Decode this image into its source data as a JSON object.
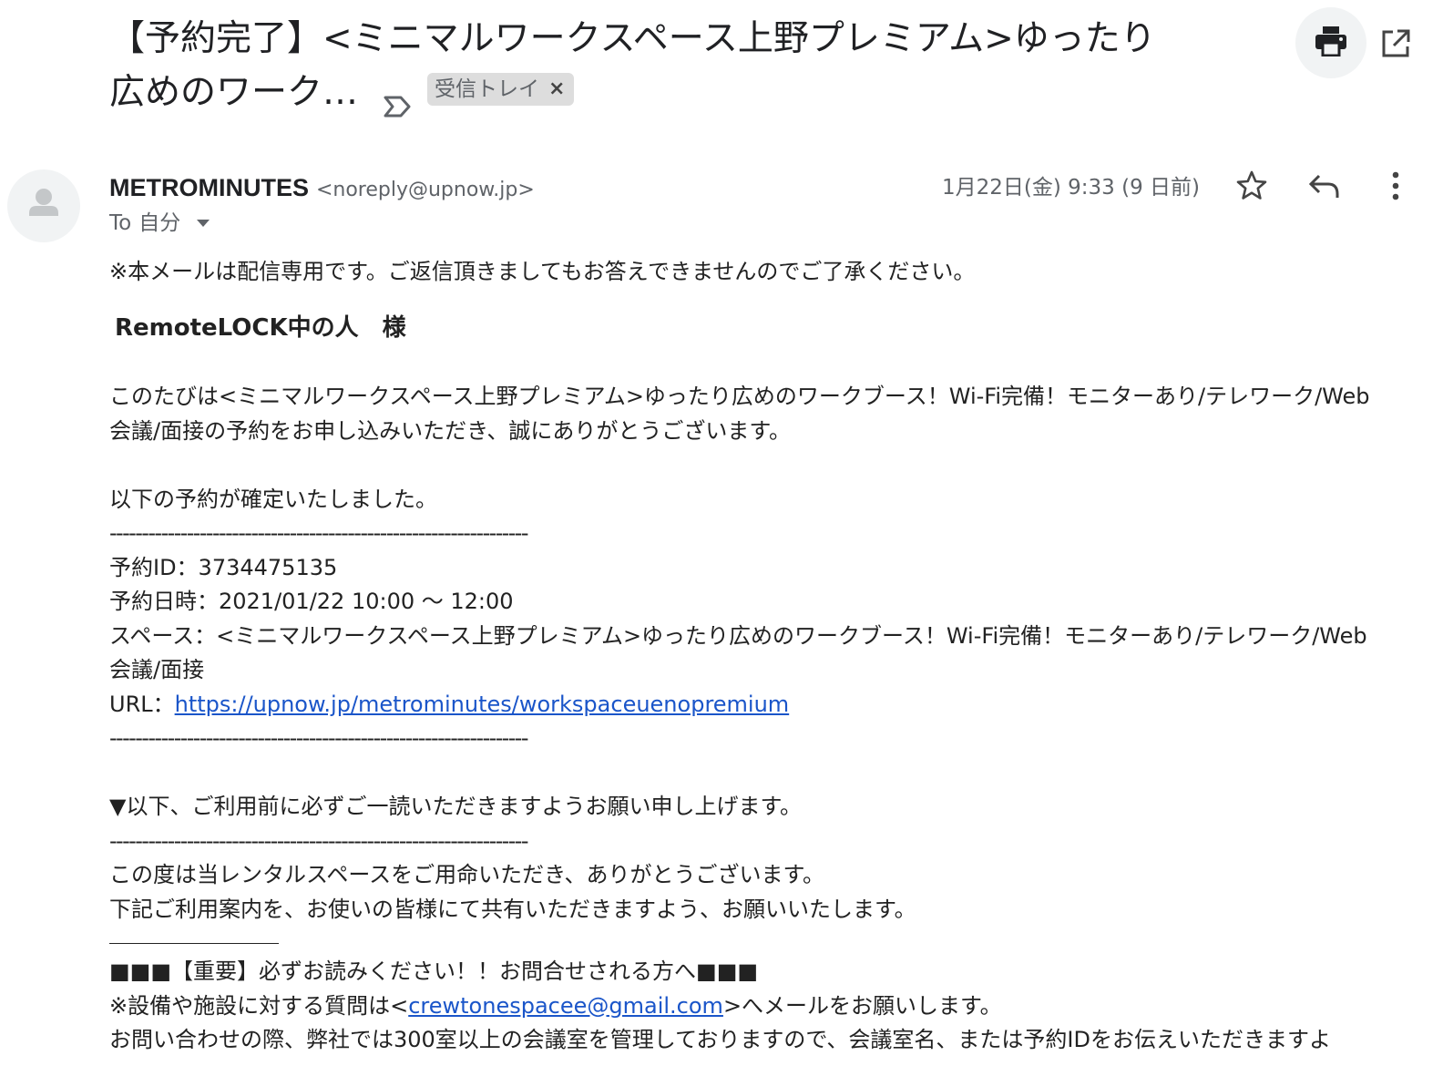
{
  "subject": {
    "line1": "【予約完了】<ミニマルワークスペース上野プレミアム>ゆったり",
    "line2": "広めのワーク…",
    "label_chip": "受信トレイ",
    "chip_close": "×"
  },
  "toolbar": {
    "print_icon": "printer-icon",
    "open_new_window_icon": "external-link-icon"
  },
  "message": {
    "sender_name": "METROMINUTES",
    "sender_email": "<noreply@upnow.jp>",
    "to_label": "To",
    "to_value": "自分",
    "date": "1月22日(金) 9:33 (9 日前)",
    "icons": [
      "avatar-icon",
      "star-icon",
      "reply-icon",
      "more-vert-icon"
    ]
  },
  "body": {
    "notice": "※本メールは配信専用です。ご返信頂きましてもお答えできませんのでご了承ください。",
    "greeting": "RemoteLOCK中の人　様",
    "intro": "このたびは<ミニマルワークスペース上野プレミアム>ゆったり広めのワークブース！Wi-Fi完備！モニターあり/テレワーク/Web会議/面接の予約をお申し込みいただき、誠にありがとうございます。",
    "confirmed": "以下の予約が確定いたしました。",
    "divider": "-----------------------------------------------------------------",
    "reservation_id": "予約ID：3734475135",
    "reservation_datetime": "予約日時：2021/01/22 10:00 〜 12:00",
    "space": "スペース：<ミニマルワークスペース上野プレミアム>ゆったり広めのワークブース！Wi-Fi完備！モニターあり/テレワーク/Web会議/面接",
    "url_label": "URL：",
    "url": "https://upnow.jp/metrominutes/workspaceuenopremium",
    "please_read": "▼以下、ご利用前に必ずご一読いただきますようお願い申し上げます。",
    "thanks": "この度は当レンタルスペースをご用命いただき、ありがとうございます。",
    "share": "下記ご利用案内を、お使いの皆様にて共有いただきますよう、お願いいたします。",
    "important": "■■■【重要】必ずお読みください！！お問合せされる方へ■■■",
    "contact_prefix": "※設備や施設に対する質問は<",
    "contact_email": "crewtonespacee@gmail.com",
    "contact_suffix": ">へメールをお願いします。",
    "cutoff": "お問い合わせの際、弊社では300室以上の会議室を管理しておりますので、会議室名、または予約IDをお伝えいただきますよ"
  }
}
